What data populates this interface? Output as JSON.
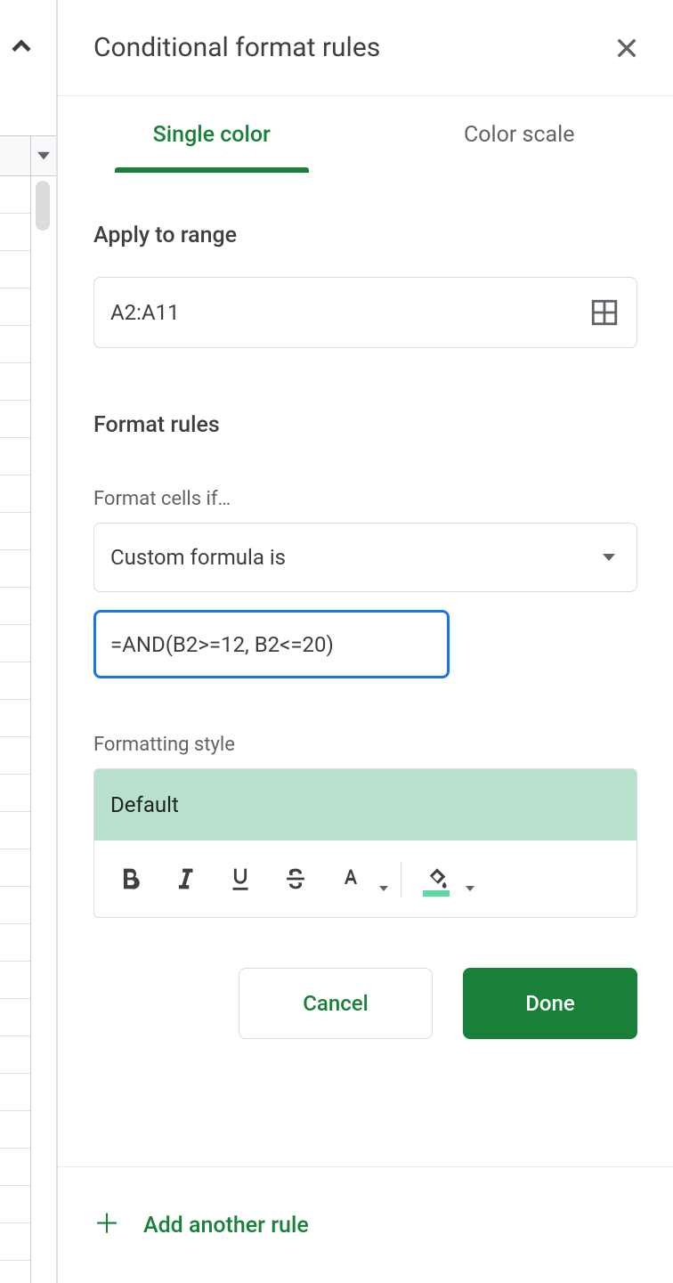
{
  "sidebar": {
    "title": "Conditional format rules",
    "tabs": {
      "single": "Single color",
      "scale": "Color scale"
    },
    "apply_heading": "Apply to range",
    "range_value": "A2:A11",
    "rules_heading": "Format rules",
    "cells_if_label": "Format cells if…",
    "condition_selected": "Custom formula is",
    "formula_value": "=AND(B2>=12, B2<=20)",
    "style_label": "Formatting style",
    "style_name": "Default",
    "cancel": "Cancel",
    "done": "Done",
    "add_rule": "Add another rule"
  },
  "colors": {
    "accent": "#188038",
    "preview_bg": "#b7e1cd",
    "focus": "#1a73e8"
  }
}
